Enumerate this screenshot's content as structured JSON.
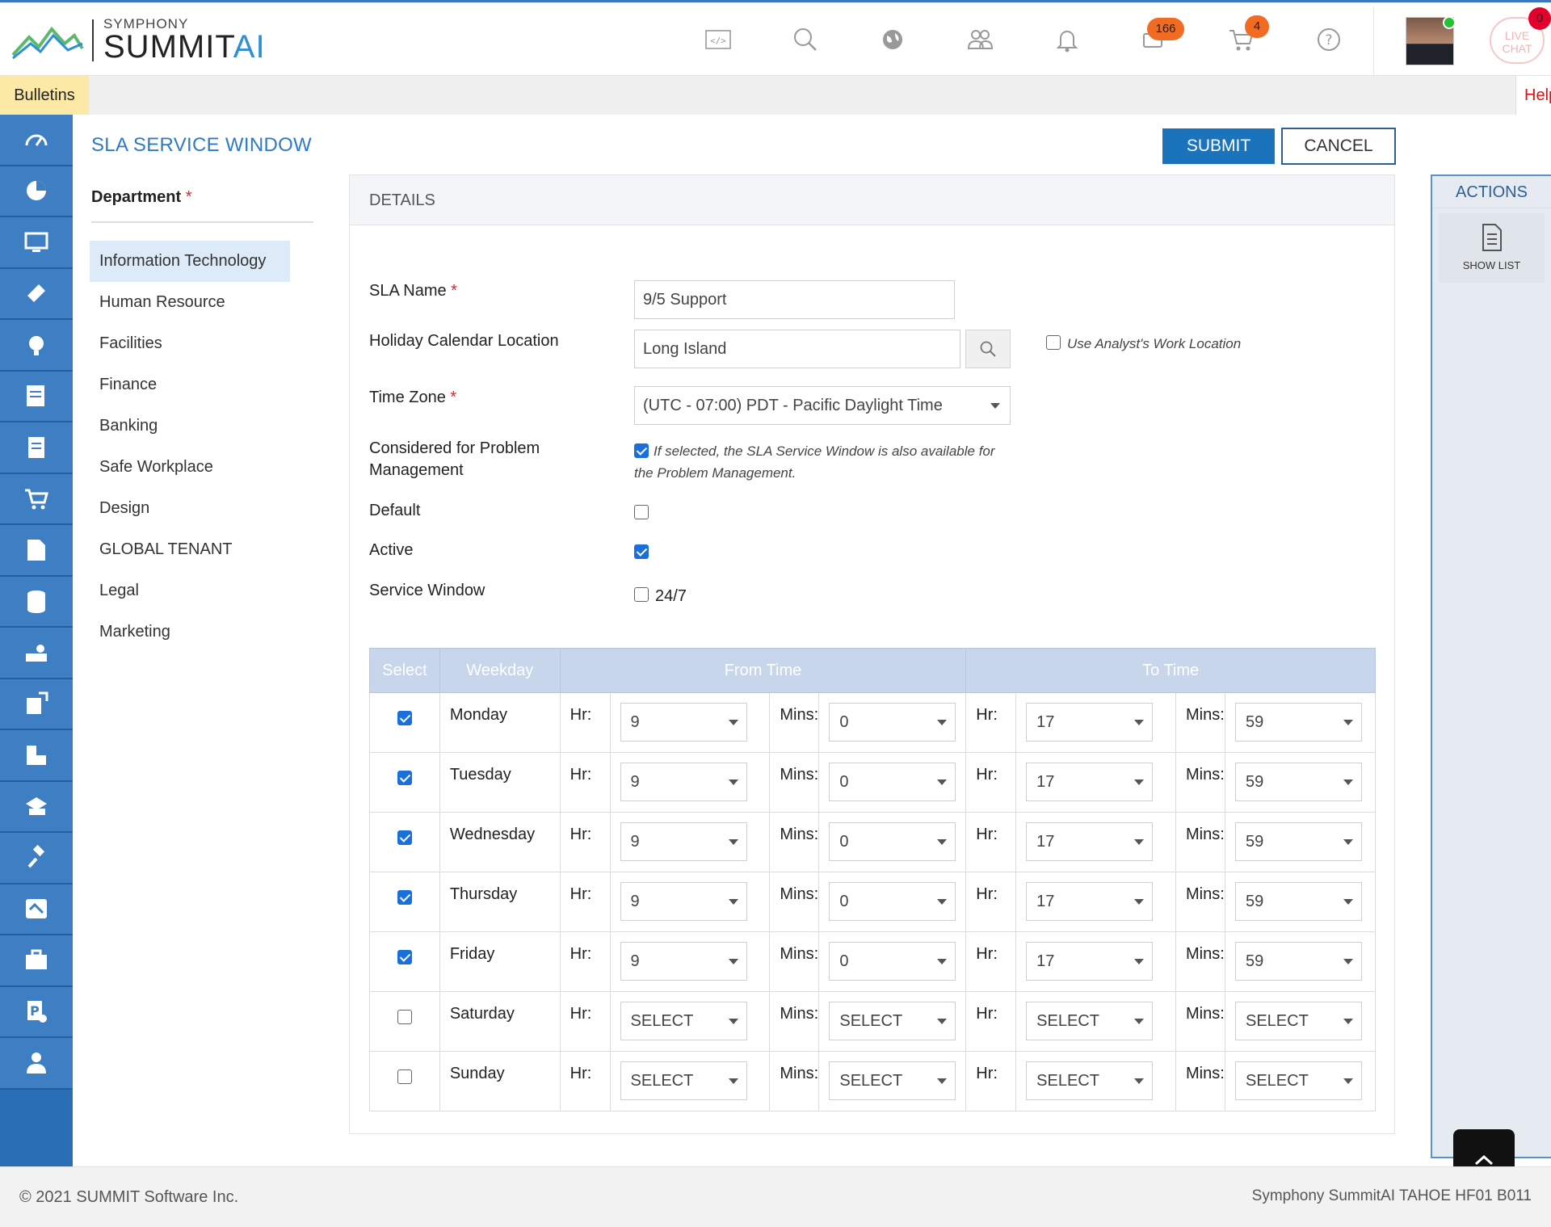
{
  "header": {
    "logo_top": "SYMPHONY",
    "logo_main": "SUMMIT",
    "logo_ai": "AI",
    "icons": [
      "code-icon",
      "search-icon",
      "globe-icon",
      "users-icon",
      "bell-icon",
      "chat-bubble-icon",
      "cart-icon",
      "help-icon"
    ],
    "chat_badge": "166",
    "cart_badge": "4",
    "live_chat_line1": "LIVE",
    "live_chat_line2": "CHAT",
    "live_chat_badge": "0"
  },
  "bulletins": {
    "label": "Bulletins",
    "right_text": "Help"
  },
  "leftnav": {
    "items": [
      "dashboard-icon",
      "pie-chart-icon",
      "monitor-icon",
      "ticket-icon",
      "support-agent-icon",
      "form-icon",
      "settings-list-icon",
      "shopping-cart-icon",
      "edit-document-icon",
      "database-icon",
      "device-icon",
      "export-icon",
      "puzzle-icon",
      "knowledge-icon",
      "gavel-icon",
      "handshake-icon",
      "briefcase-icon",
      "p-badge-icon",
      "user-icon"
    ]
  },
  "page": {
    "title": "SLA SERVICE WINDOW",
    "submit_label": "SUBMIT",
    "cancel_label": "CANCEL"
  },
  "department": {
    "label": "Department",
    "required_mark": "*",
    "items": [
      "Information Technology",
      "Human Resource",
      "Facilities",
      "Finance",
      "Banking",
      "Safe Workplace",
      "Design",
      "GLOBAL TENANT",
      "Legal",
      "Marketing"
    ],
    "selected": "Information Technology"
  },
  "details": {
    "heading": "DETAILS",
    "sla_name_label": "SLA Name",
    "sla_name_value": "9/5 Support",
    "holiday_label": "Holiday Calendar Location",
    "holiday_value": "Long Island",
    "use_analyst_label": "Use Analyst's Work Location",
    "use_analyst_checked": false,
    "timezone_label": "Time Zone",
    "timezone_value": "(UTC - 07:00) PDT - Pacific Daylight Time",
    "problem_label": "Considered for Problem Management",
    "problem_checked": true,
    "problem_note": "If selected, the SLA Service Window is also available for the Problem Management.",
    "default_label": "Default",
    "default_checked": false,
    "active_label": "Active",
    "active_checked": true,
    "service_window_label": "Service Window",
    "service_window_247_label": "24/7",
    "service_window_247_checked": false,
    "required_mark": "*"
  },
  "schedule": {
    "headers": {
      "select": "Select",
      "weekday": "Weekday",
      "from": "From Time",
      "to": "To Time"
    },
    "hr_label": "Hr:",
    "mins_label": "Mins:",
    "rows": [
      {
        "day": "Monday",
        "checked": true,
        "from_hr": "9",
        "from_min": "0",
        "to_hr": "17",
        "to_min": "59"
      },
      {
        "day": "Tuesday",
        "checked": true,
        "from_hr": "9",
        "from_min": "0",
        "to_hr": "17",
        "to_min": "59"
      },
      {
        "day": "Wednesday",
        "checked": true,
        "from_hr": "9",
        "from_min": "0",
        "to_hr": "17",
        "to_min": "59"
      },
      {
        "day": "Thursday",
        "checked": true,
        "from_hr": "9",
        "from_min": "0",
        "to_hr": "17",
        "to_min": "59"
      },
      {
        "day": "Friday",
        "checked": true,
        "from_hr": "9",
        "from_min": "0",
        "to_hr": "17",
        "to_min": "59"
      },
      {
        "day": "Saturday",
        "checked": false,
        "from_hr": "SELECT",
        "from_min": "SELECT",
        "to_hr": "SELECT",
        "to_min": "SELECT"
      },
      {
        "day": "Sunday",
        "checked": false,
        "from_hr": "SELECT",
        "from_min": "SELECT",
        "to_hr": "SELECT",
        "to_min": "SELECT"
      }
    ]
  },
  "actions": {
    "heading": "ACTIONS",
    "show_list_label": "SHOW LIST"
  },
  "footer": {
    "copyright": "© 2021 SUMMIT Software Inc.",
    "version": "Symphony SummitAI TAHOE HF01 B011"
  },
  "colors": {
    "brand_blue": "#1b74bb",
    "nav_blue": "#3e7fc3",
    "title_blue": "#2d7bc4",
    "required_red": "#d9252a",
    "badge_orange": "#f26b22"
  }
}
